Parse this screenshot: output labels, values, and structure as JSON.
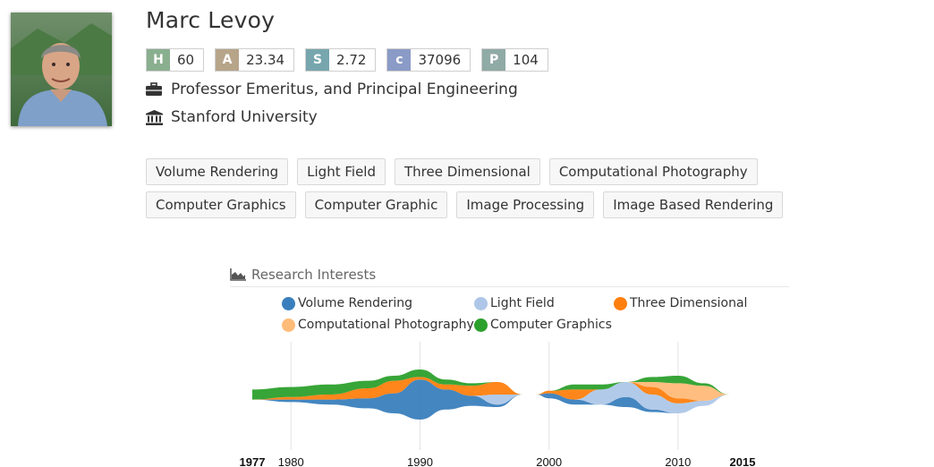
{
  "profile": {
    "name": "Marc Levoy",
    "position": "Professor Emeritus, and Principal Engineering",
    "affiliation": "Stanford University",
    "metrics": [
      {
        "label": "H",
        "value": "60",
        "color": "#8aaf8f"
      },
      {
        "label": "A",
        "value": "23.34",
        "color": "#b7a58a"
      },
      {
        "label": "S",
        "value": "2.72",
        "color": "#77a6ae"
      },
      {
        "label": "c",
        "value": "37096",
        "color": "#8b9bc7"
      },
      {
        "label": "P",
        "value": "104",
        "color": "#90aaa5"
      }
    ],
    "tags": [
      "Volume Rendering",
      "Light Field",
      "Three Dimensional",
      "Computational Photography",
      "Computer Graphics",
      "Computer Graphic",
      "Image Processing",
      "Image Based Rendering"
    ]
  },
  "research_interests": {
    "title": "Research Interests",
    "legend": [
      {
        "name": "Volume Rendering",
        "color": "#3a7fbd"
      },
      {
        "name": "Light Field",
        "color": "#aec7e8"
      },
      {
        "name": "Three Dimensional",
        "color": "#ff7f0e"
      },
      {
        "name": "Computational Photography",
        "color": "#ffbb78"
      },
      {
        "name": "Computer Graphics",
        "color": "#2ca02c"
      }
    ]
  },
  "chart_data": {
    "type": "area",
    "layout": "streamgraph",
    "x_ticks": [
      "1977",
      "1980",
      "1990",
      "2000",
      "2010",
      "2015"
    ],
    "x_ticks_bold": [
      "1977",
      "2015"
    ],
    "gridlines_at": [
      1980,
      1990,
      2000,
      2010
    ],
    "xlim": [
      1977,
      2015
    ],
    "x": [
      1977,
      1980,
      1983,
      1986,
      1988,
      1990,
      1992,
      1994,
      1996,
      1998,
      1999,
      2000,
      2002,
      2004,
      2006,
      2008,
      2010,
      2012,
      2014,
      2015
    ],
    "series": [
      {
        "name": "Volume Rendering",
        "color": "#3a7fbd",
        "values": [
          0,
          0.5,
          1,
          2,
          4,
          8,
          4,
          2,
          0.5,
          0,
          0,
          1,
          1,
          0,
          2,
          0.5,
          0,
          0,
          0,
          0
        ]
      },
      {
        "name": "Light Field",
        "color": "#aec7e8",
        "values": [
          0,
          0,
          0,
          0,
          0,
          0,
          0,
          0,
          2,
          0,
          0,
          0,
          0,
          3,
          3,
          3,
          2,
          1,
          0,
          0
        ]
      },
      {
        "name": "Three Dimensional",
        "color": "#ff7f0e",
        "values": [
          0,
          0.5,
          1,
          2,
          2.5,
          0.5,
          1,
          2,
          2.5,
          0,
          0,
          0.5,
          2,
          0,
          0,
          1.5,
          1,
          0,
          0,
          0
        ]
      },
      {
        "name": "Computational Photography",
        "color": "#ffbb78",
        "values": [
          0,
          0,
          0,
          0,
          0,
          0,
          0,
          0,
          0,
          0,
          0,
          0,
          0,
          0,
          0,
          1,
          3,
          3,
          0,
          0
        ]
      },
      {
        "name": "Computer Graphics",
        "color": "#2ca02c",
        "values": [
          2,
          2,
          2,
          1.5,
          1,
          1.5,
          1,
          0.5,
          0,
          0,
          0,
          0,
          1,
          1,
          0,
          1,
          1.5,
          0.5,
          0,
          0
        ]
      }
    ]
  }
}
